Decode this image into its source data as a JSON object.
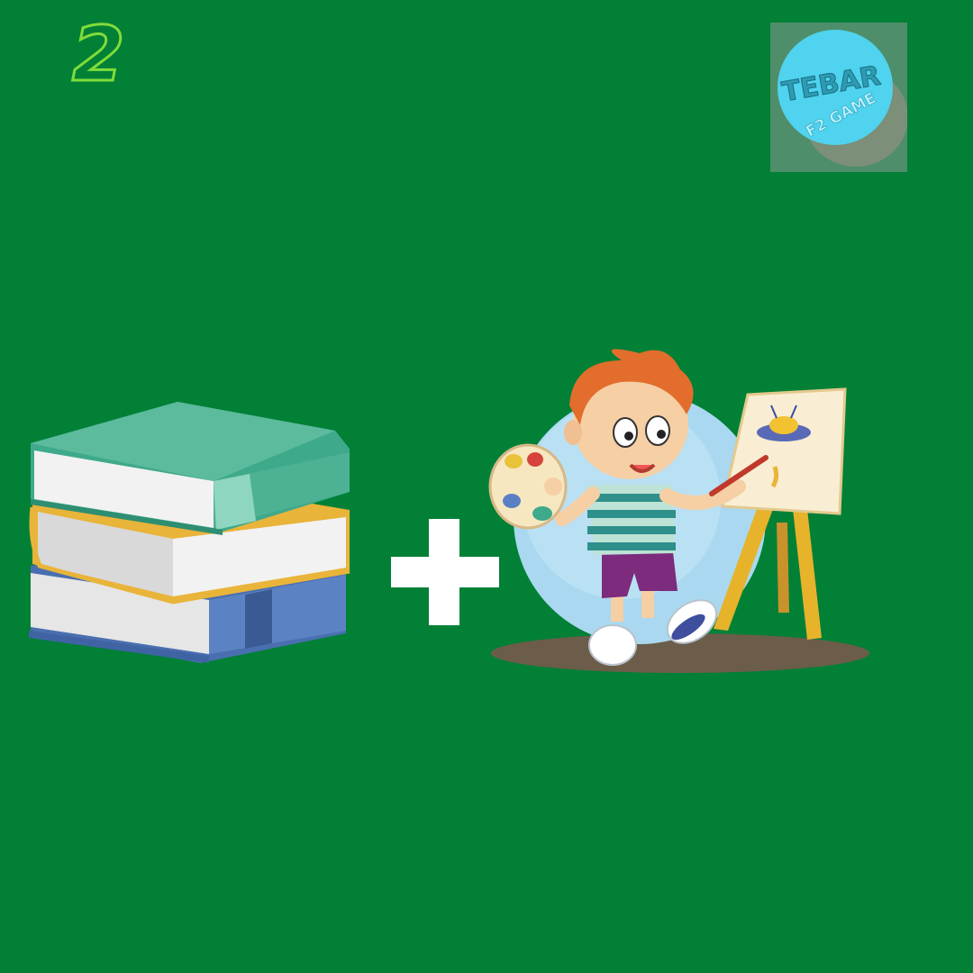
{
  "puzzle": {
    "level_number": "2",
    "logo": {
      "line1": "TEBAR",
      "line2": "F2 GAME"
    },
    "clue_left_icon": "stack-of-books",
    "operator": "plus",
    "clue_right_icon": "boy-painting-at-easel"
  },
  "colors": {
    "background": "#018036",
    "level_number_outline": "#7fdc3a",
    "logo_circle": "#4fd3ee",
    "plus_sign": "#ffffff"
  }
}
